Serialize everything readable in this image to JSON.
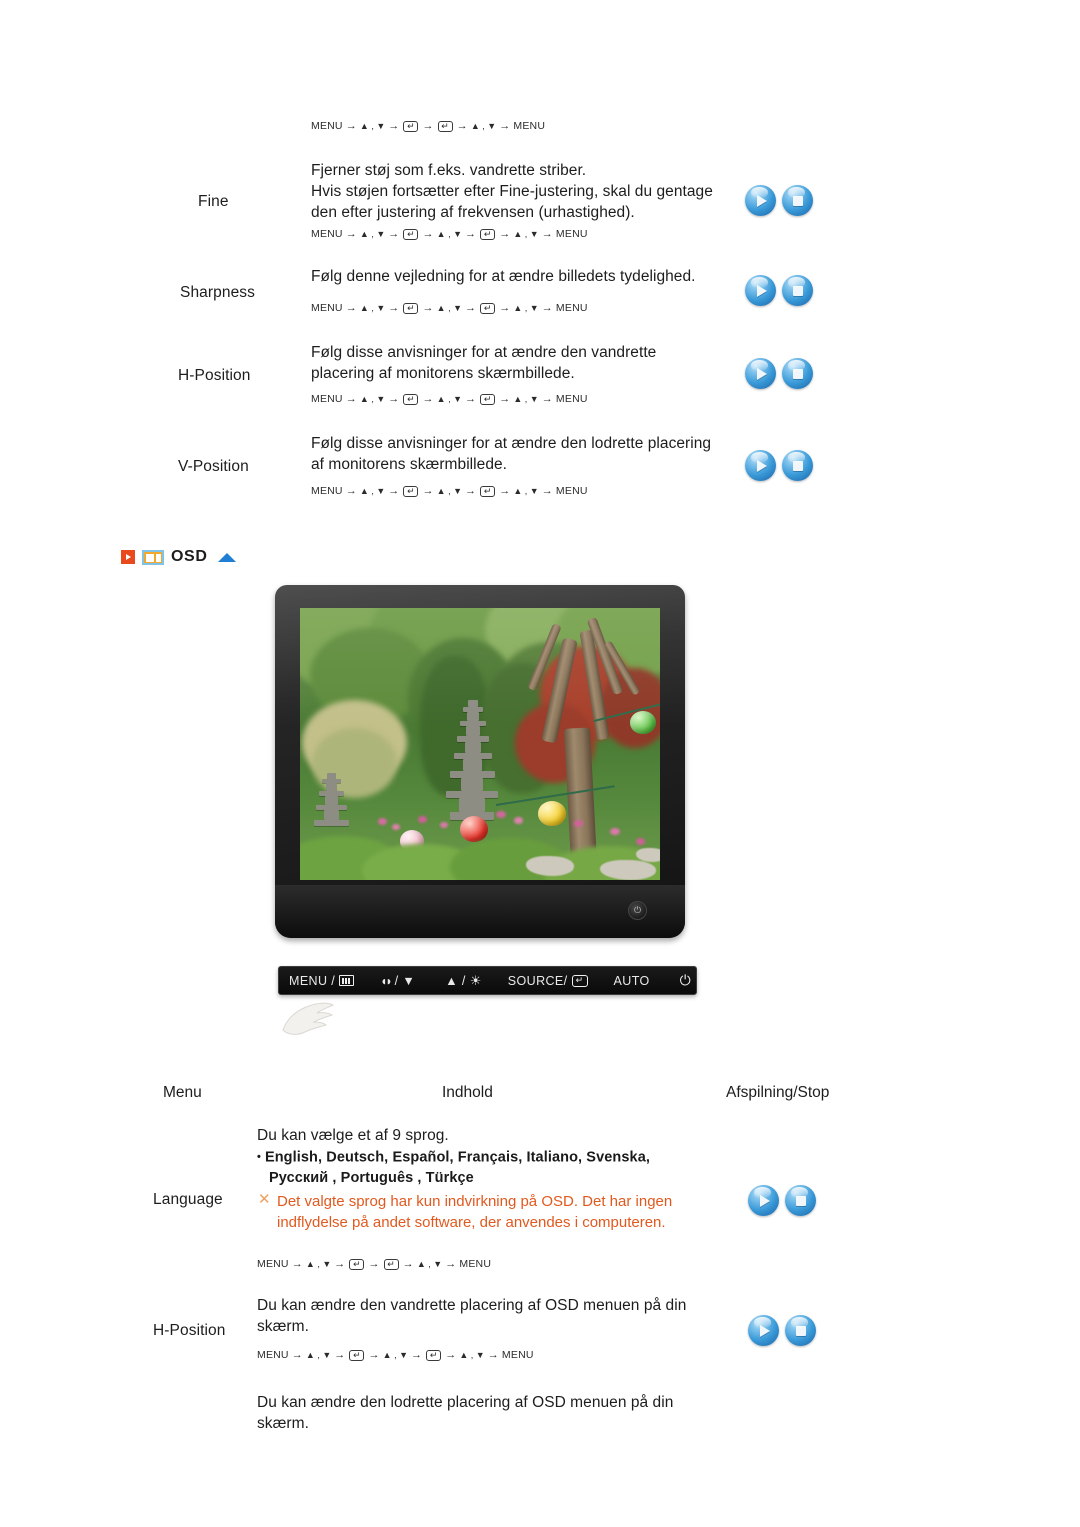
{
  "page": {
    "language": "da",
    "accent_orange": "#e8491d",
    "note_color": "#e2591f",
    "blue": "#2f8fd0"
  },
  "top_section": {
    "path_top": {
      "start": "MENU",
      "end": "MENU",
      "tokens": [
        "MENU",
        "▲ , ▼",
        "⏎",
        "⏎",
        "▲ , ▼",
        "MENU"
      ]
    },
    "rows": [
      {
        "menu": "Fine",
        "desc_lines": [
          "Fjerner støj som f.eks. vandrette striber.",
          "Hvis støjen fortsætter efter Fine-justering, skal du gentage",
          "den efter justering af frekvensen (urhastighed)."
        ],
        "path_tokens": [
          "MENU",
          "▲ , ▼",
          "⏎",
          "▲ , ▼",
          "⏎",
          "▲ , ▼",
          "MENU"
        ]
      },
      {
        "menu": "Sharpness",
        "desc_lines": [
          "Følg denne vejledning for at ændre billedets tydelighed."
        ],
        "path_tokens": [
          "MENU",
          "▲ , ▼",
          "⏎",
          "▲ , ▼",
          "⏎",
          "▲ , ▼",
          "MENU"
        ]
      },
      {
        "menu": "H-Position",
        "desc_lines": [
          "Følg disse anvisninger for at ændre den vandrette",
          "placering af monitorens skærmbillede."
        ],
        "path_tokens": [
          "MENU",
          "▲ , ▼",
          "⏎",
          "▲ , ▼",
          "⏎",
          "▲ , ▼",
          "MENU"
        ]
      },
      {
        "menu": "V-Position",
        "desc_lines": [
          "Følg disse anvisninger for at ændre den lodrette placering",
          "af monitorens skærmbillede."
        ],
        "path_tokens": [
          "MENU",
          "▲ , ▼",
          "⏎",
          "▲ , ▼",
          "⏎",
          "▲ , ▼",
          "MENU"
        ]
      }
    ]
  },
  "osd_section": {
    "header": {
      "title": "OSD",
      "arrow_icon": "play-triangle-icon",
      "screen_icon": "monitor-screen-icon",
      "up_icon": "blue-triangle-up-icon"
    },
    "monitor": {
      "power_icon": "power-icon",
      "screen_alt": "garden-photo",
      "control_bar": {
        "items": [
          {
            "label": "MENU /",
            "icon": "menu-bars-icon"
          },
          {
            "label": "/ ▼",
            "icon": "sound-icon"
          },
          {
            "label": "▲ /",
            "icon": "brightness-icon"
          },
          {
            "label": "SOURCE/",
            "icon": "enter-key-icon"
          },
          {
            "label": "AUTO",
            "icon": ""
          },
          {
            "label": "",
            "icon": "power-icon"
          }
        ]
      },
      "hand_cursor_icon": "hand-cursor-icon"
    },
    "columns": {
      "menu": "Menu",
      "content": "Indhold",
      "playstop": "Afspilning/Stop"
    },
    "rows": [
      {
        "menu": "Language",
        "intro": "Du kan vælge et af 9 sprog.",
        "languages_line1": "English, Deutsch, Español, Français,  Italiano, Svenska,",
        "languages_line2": "Русский , Português , Türkçe",
        "note_mark": "✕",
        "note_lines": [
          "Det valgte sprog har kun indvirkning på OSD. Det har ingen",
          "indflydelse på andet software, der anvendes i computeren."
        ],
        "path_tokens": [
          "MENU",
          "▲ , ▼",
          "⏎",
          "⏎",
          "▲ , ▼",
          "MENU"
        ]
      },
      {
        "menu": "H-Position",
        "desc_lines": [
          "Du kan ændre den vandrette placering af OSD menuen på din",
          "skærm."
        ],
        "path_tokens": [
          "MENU",
          "▲ , ▼",
          "⏎",
          "▲ , ▼",
          "⏎",
          "▲ , ▼",
          "MENU"
        ]
      },
      {
        "menu": "",
        "desc_lines": [
          "Du kan ændre den lodrette placering af OSD menuen på din",
          "skærm."
        ]
      }
    ]
  }
}
